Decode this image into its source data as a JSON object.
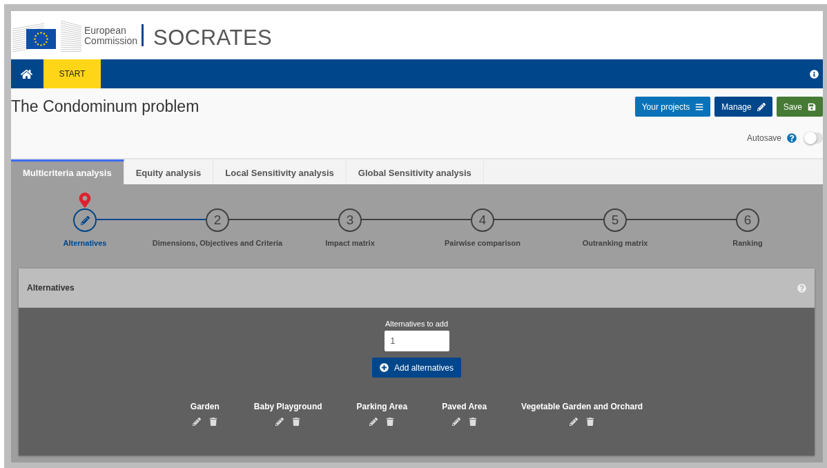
{
  "header": {
    "brand_line_1": "European",
    "brand_line_2": "Commission",
    "app_name": "SOCRATES"
  },
  "nav": {
    "items": [
      {
        "label": "START",
        "selected": true
      }
    ]
  },
  "project": {
    "title": "The Condominum problem",
    "buttons": [
      {
        "label": "Your projects",
        "kind": "projects"
      },
      {
        "label": "Manage",
        "kind": "manage"
      },
      {
        "label": "Save",
        "kind": "save"
      }
    ],
    "autosave": {
      "label": "Autosave",
      "on": false
    }
  },
  "tabs": [
    {
      "label": "Multicriteria analysis",
      "selected": true
    },
    {
      "label": "Equity analysis",
      "selected": false
    },
    {
      "label": "Local Sensitivity analysis",
      "selected": false
    },
    {
      "label": "Global Sensitivity analysis",
      "selected": false
    }
  ],
  "steps": [
    {
      "label": "Alternatives",
      "selected": true
    },
    {
      "number": "2",
      "label": "Dimensions, Objectives and Criteria",
      "selected": false
    },
    {
      "number": "3",
      "label": "Impact matrix",
      "selected": false
    },
    {
      "number": "4",
      "label": "Pairwise comparison",
      "selected": false
    },
    {
      "number": "5",
      "label": "Outranking matrix",
      "selected": false
    },
    {
      "number": "6",
      "label": "Ranking",
      "selected": false
    }
  ],
  "panel": {
    "title": "Alternatives",
    "field_label": "Alternatives to add",
    "field_value": "1",
    "add_button": "Add alternatives",
    "alternatives": [
      {
        "name": "Garden"
      },
      {
        "name": "Baby Playground"
      },
      {
        "name": "Parking Area"
      },
      {
        "name": "Paved Area"
      },
      {
        "name": "Vegetable Garden and Orchard"
      }
    ]
  }
}
